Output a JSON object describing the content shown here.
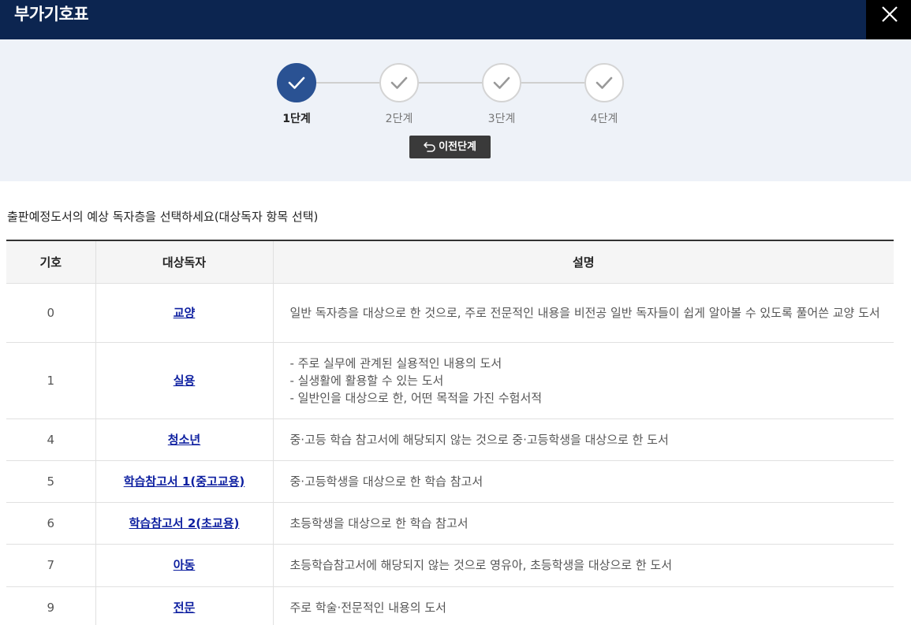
{
  "header": {
    "title": "부가기호표"
  },
  "steps": [
    {
      "label": "1단계",
      "active": true
    },
    {
      "label": "2단계",
      "active": false
    },
    {
      "label": "3단계",
      "active": false
    },
    {
      "label": "4단계",
      "active": false
    }
  ],
  "prev_button": {
    "label": "이전단계"
  },
  "instruction": "출판예정도서의 예상 독자층을 선택하세요(대상독자 항목 선택)",
  "table": {
    "headers": [
      "기호",
      "대상독자",
      "설명"
    ],
    "rows": [
      {
        "code": "0",
        "name": "교양",
        "desc": [
          "일반 독자층을 대상으로 한 것으로, 주로 전문적인 내용을 비전공 일반 독자들이 쉽게 알아볼 수 있도록 풀어쓴 교양 도서"
        ]
      },
      {
        "code": "1",
        "name": "실용",
        "desc": [
          "- 주로 실무에 관계된 실용적인 내용의 도서",
          "- 실생활에 활용할 수 있는 도서",
          "- 일반인을 대상으로 한, 어떤 목적을 가진 수험서적"
        ]
      },
      {
        "code": "4",
        "name": "청소년",
        "desc": [
          "중·고등 학습 참고서에 해당되지 않는 것으로 중·고등학생을 대상으로 한 도서"
        ]
      },
      {
        "code": "5",
        "name": "학습참고서 1(중고교용)",
        "desc": [
          "중·고등학생을 대상으로 한 학습 참고서"
        ]
      },
      {
        "code": "6",
        "name": "학습참고서 2(초교용)",
        "desc": [
          "초등학생을 대상으로 한 학습 참고서"
        ]
      },
      {
        "code": "7",
        "name": "아동",
        "desc": [
          "초등학습참고서에 해당되지 않는 것으로 영유아, 초등학생을 대상으로 한 도서"
        ]
      },
      {
        "code": "9",
        "name": "전문",
        "desc": [
          "주로 학술·전문적인 내용의 도서"
        ]
      }
    ]
  },
  "colors": {
    "header_bg": "#0c2550",
    "step_active": "#2a5293",
    "link": "#0d1fa0"
  }
}
